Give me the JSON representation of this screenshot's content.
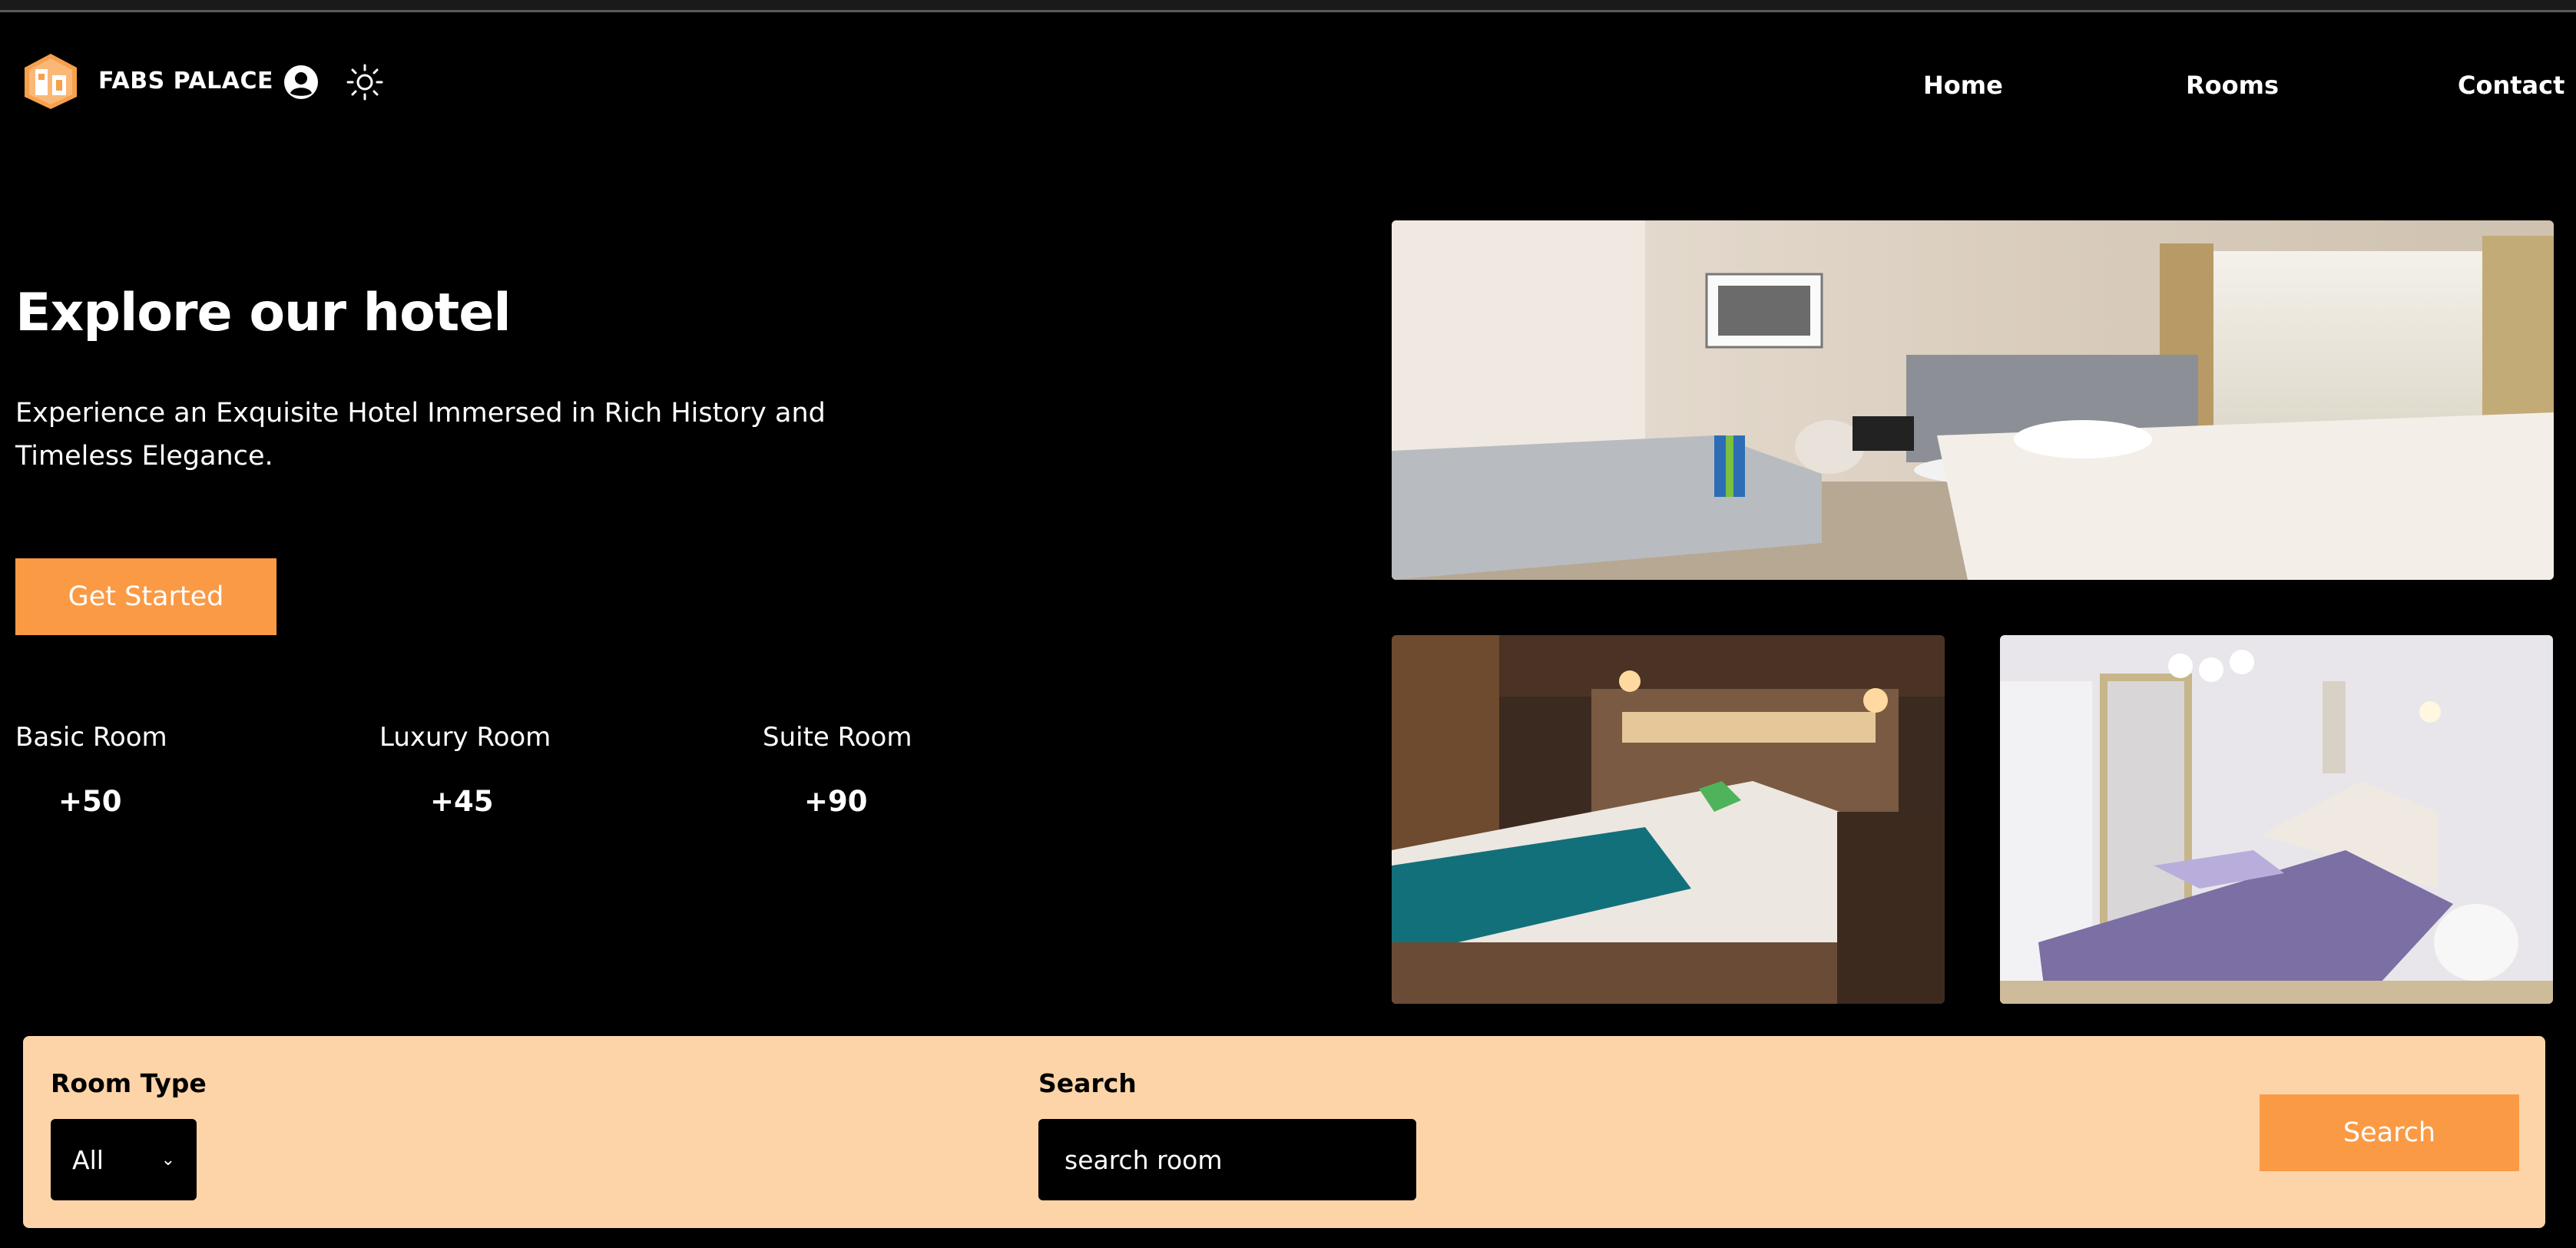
{
  "header": {
    "brand": "FABS PALACE",
    "logo_icon": "hotel-logo-icon",
    "user_icon": "user-circle-icon",
    "theme_icon": "sun-icon",
    "nav": [
      "Home",
      "Rooms",
      "Contact"
    ]
  },
  "hero": {
    "title": "Explore our hotel",
    "subtitle": "Experience an Exquisite Hotel Immersed in Rich History and Timeless Elegance.",
    "cta_label": "Get Started"
  },
  "stats": [
    {
      "label": "Basic Room",
      "value": "+50"
    },
    {
      "label": "Luxury Room",
      "value": "+45"
    },
    {
      "label": "Suite Room",
      "value": "+90"
    }
  ],
  "search": {
    "room_type_label": "Room Type",
    "room_type_value": "All",
    "search_label": "Search",
    "search_placeholder": "search room",
    "button_label": "Search"
  },
  "colors": {
    "accent": "#fb9a45",
    "search_panel": "#fdd4a8",
    "background": "#000000"
  }
}
